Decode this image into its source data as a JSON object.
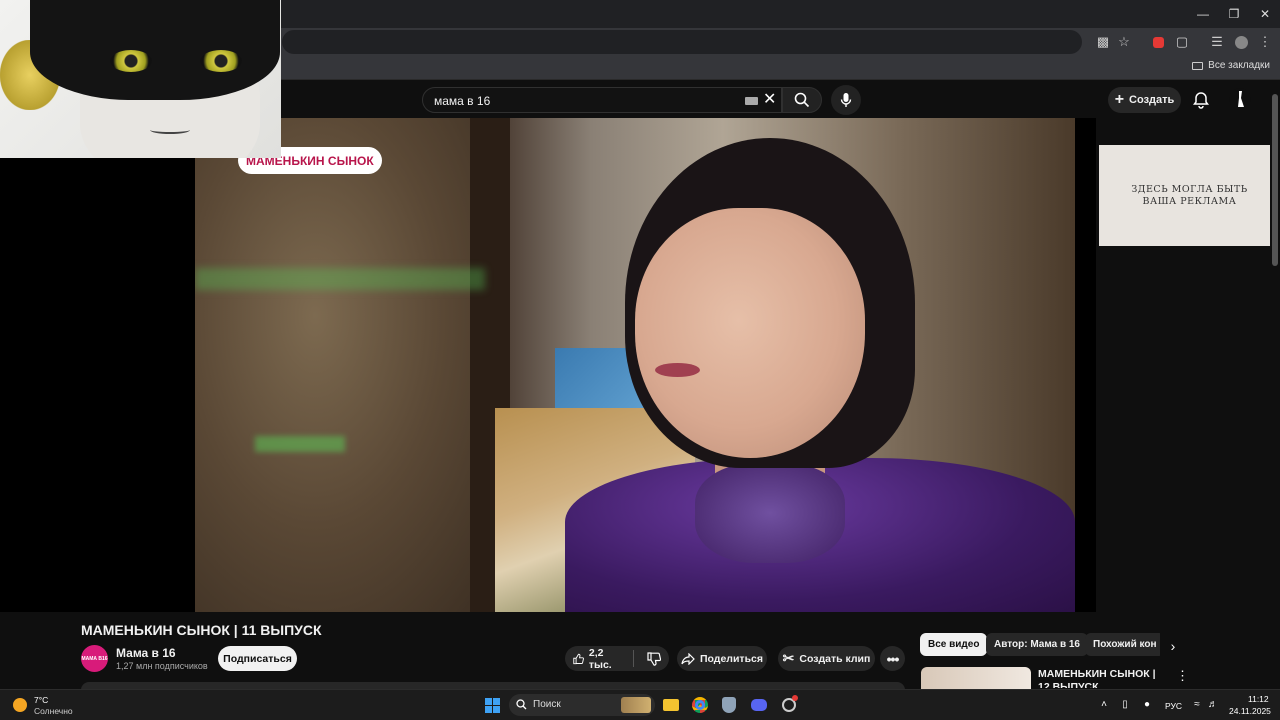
{
  "browser": {
    "bookmarks_all": "Все закладки"
  },
  "header": {
    "search_value": "мама в 16",
    "create_label": "Создать"
  },
  "video": {
    "overlay_badge": "МАМЕНЬКИН СЫНОК",
    "title": "МАМЕНЬКИН СЫНОК | 11 ВЫПУСК"
  },
  "ad": {
    "text_line1": "ЗДЕСЬ МОГЛА БЫТЬ",
    "text_line2": "ВАША РЕКЛАМА"
  },
  "channel": {
    "name": "Мама в 16",
    "subscribers": "1,27 млн подписчиков",
    "subscribe_label": "Подписаться",
    "avatar_text": "МАМА В16"
  },
  "actions": {
    "likes": "2,2 тыс.",
    "share": "Поделиться",
    "clip": "Создать клип"
  },
  "sidebar": {
    "chips": [
      "Все видео",
      "Автор: Мама в 16",
      "Похожий кон"
    ],
    "rec_title": "МАМЕНЬКИН СЫНОК | 12 ВЫПУСК"
  },
  "taskbar": {
    "weather_temp": "7°C",
    "weather_desc": "Солнечно",
    "search_label": "Поиск",
    "lang": "РУС",
    "time": "11:12",
    "date": "24.11.2025"
  },
  "colors": {
    "bg": "#0f0f0f",
    "accent_red": "#b8154b",
    "channel_pink": "#d81b7a"
  }
}
